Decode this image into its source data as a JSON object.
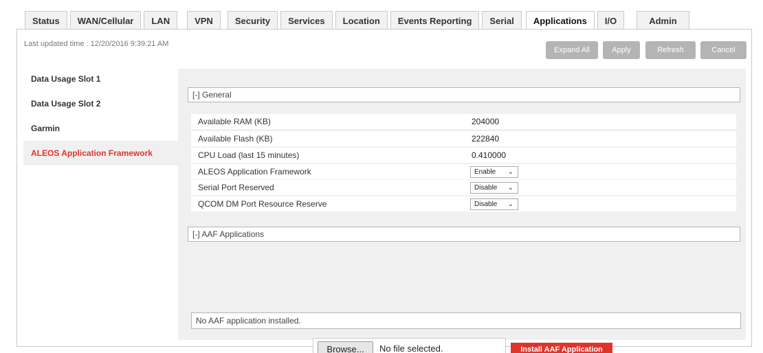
{
  "tabs": [
    {
      "label": "Status"
    },
    {
      "label": "WAN/Cellular"
    },
    {
      "label": "LAN"
    },
    {
      "label": "VPN"
    },
    {
      "label": "Security"
    },
    {
      "label": "Services"
    },
    {
      "label": "Location"
    },
    {
      "label": "Events Reporting"
    },
    {
      "label": "Serial"
    },
    {
      "label": "Applications",
      "active": true
    },
    {
      "label": "I/O"
    },
    {
      "label": "Admin"
    }
  ],
  "header": {
    "last_updated": "Last updated time : 12/20/2016 9:39:21 AM"
  },
  "toolbar": {
    "expand_all": "Expand All",
    "apply": "Apply",
    "refresh": "Refresh",
    "cancel": "Cancel"
  },
  "sidebar": {
    "items": [
      {
        "label": "Data Usage Slot 1"
      },
      {
        "label": "Data Usage Slot 2"
      },
      {
        "label": "Garmin"
      },
      {
        "label": "ALEOS Application Framework",
        "active": true
      }
    ]
  },
  "general": {
    "header": "[-] General",
    "rows": [
      {
        "label": "Available RAM (KB)",
        "value": "204000"
      },
      {
        "label": "Available Flash (KB)",
        "value": "222840"
      },
      {
        "label": "CPU Load (last 15 minutes)",
        "value": "0.410000"
      },
      {
        "label": "ALEOS Application Framework",
        "value": "Enable"
      },
      {
        "label": "Serial Port Reserved",
        "value": "Disable"
      },
      {
        "label": "QCOM DM Port Resource Reserve",
        "value": "Disable"
      }
    ]
  },
  "aaf": {
    "header": "[-] AAF Applications",
    "no_app": "No AAF application installed.",
    "browse": "Browse...",
    "no_file": "No file selected.",
    "install": "Install AAF Application"
  },
  "colors": {
    "accent": "#e0342b",
    "button_gray": "#b4b4b4",
    "panel_bg": "#f0f0f0"
  },
  "icons": {
    "dropdown": "chevron-down-icon"
  }
}
